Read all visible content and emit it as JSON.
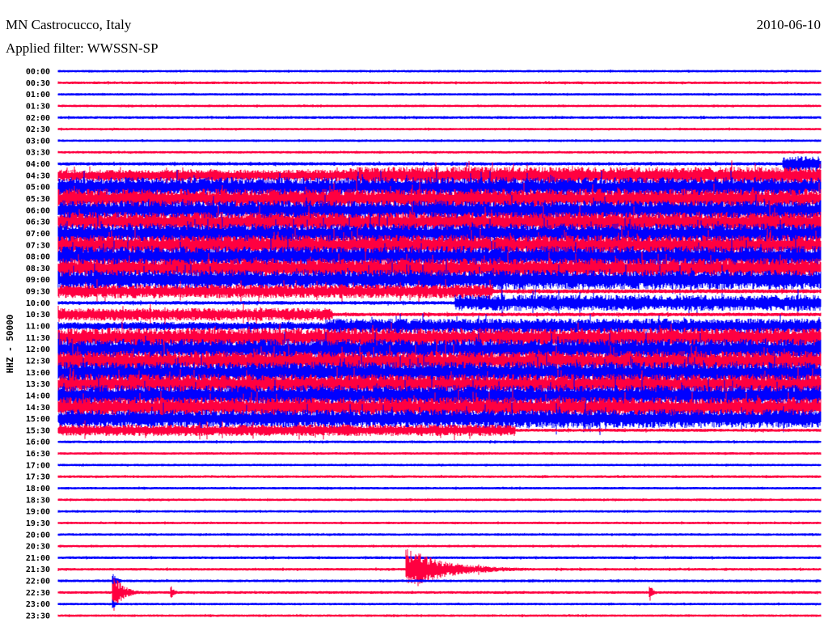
{
  "header": {
    "station": "MN Castrocucco, Italy",
    "date": "2010-06-10",
    "filter": "Applied filter: WWSSN-SP"
  },
  "chart_data": {
    "type": "line",
    "title": "MN Castrocucco, Italy",
    "ylabel": "HHZ - 50000",
    "xlabel": "",
    "row_minutes": 30,
    "colors": {
      "even": "#0000ff",
      "odd": "#ff0040"
    },
    "rows": [
      {
        "label": "00:00",
        "level": 0.05
      },
      {
        "label": "00:30",
        "level": 0.06
      },
      {
        "label": "01:00",
        "level": 0.05
      },
      {
        "label": "01:30",
        "level": 0.05
      },
      {
        "label": "02:00",
        "level": 0.06
      },
      {
        "label": "02:30",
        "level": 0.05
      },
      {
        "label": "03:00",
        "level": 0.05
      },
      {
        "label": "03:30",
        "level": 0.05
      },
      {
        "label": "04:00",
        "level": 0.09,
        "segments": [
          [
            0.95,
            1.0,
            0.6
          ]
        ]
      },
      {
        "label": "04:30",
        "level": 0.7,
        "segments": [
          [
            0.0,
            0.38,
            0.45
          ]
        ]
      },
      {
        "label": "05:00",
        "level": 0.8
      },
      {
        "label": "05:30",
        "level": 0.8
      },
      {
        "label": "06:00",
        "level": 0.8
      },
      {
        "label": "06:30",
        "level": 0.8
      },
      {
        "label": "07:00",
        "level": 0.8
      },
      {
        "label": "07:30",
        "level": 0.8
      },
      {
        "label": "08:00",
        "level": 0.85
      },
      {
        "label": "08:30",
        "level": 0.8
      },
      {
        "label": "09:00",
        "level": 0.8
      },
      {
        "label": "09:30",
        "level": 0.55,
        "segments": [
          [
            0.57,
            1.0,
            0.12
          ]
        ]
      },
      {
        "label": "10:00",
        "level": 0.1,
        "segments": [
          [
            0.52,
            1.0,
            0.65
          ]
        ]
      },
      {
        "label": "10:30",
        "level": 0.1,
        "segments": [
          [
            0.0,
            0.36,
            0.5
          ]
        ]
      },
      {
        "label": "11:00",
        "level": 0.3,
        "segments": [
          [
            0.35,
            1.0,
            0.6
          ]
        ]
      },
      {
        "label": "11:30",
        "level": 0.8
      },
      {
        "label": "12:00",
        "level": 0.85
      },
      {
        "label": "12:30",
        "level": 0.8
      },
      {
        "label": "13:00",
        "level": 0.85
      },
      {
        "label": "13:30",
        "level": 0.8
      },
      {
        "label": "14:00",
        "level": 0.85
      },
      {
        "label": "14:30",
        "level": 0.8
      },
      {
        "label": "15:00",
        "level": 0.75
      },
      {
        "label": "15:30",
        "level": 0.08,
        "segments": [
          [
            0.0,
            0.6,
            0.45
          ]
        ]
      },
      {
        "label": "16:00",
        "level": 0.06
      },
      {
        "label": "16:30",
        "level": 0.05
      },
      {
        "label": "17:00",
        "level": 0.05
      },
      {
        "label": "17:30",
        "level": 0.06
      },
      {
        "label": "18:00",
        "level": 0.05
      },
      {
        "label": "18:30",
        "level": 0.05
      },
      {
        "label": "19:00",
        "level": 0.05
      },
      {
        "label": "19:30",
        "level": 0.05
      },
      {
        "label": "20:00",
        "level": 0.05
      },
      {
        "label": "20:30",
        "level": 0.05
      },
      {
        "label": "21:00",
        "level": 0.06
      },
      {
        "label": "21:30",
        "level": 0.06,
        "events": [
          [
            0.455,
            1.8,
            0.05
          ],
          [
            0.468,
            1.6,
            0.04
          ]
        ]
      },
      {
        "label": "22:00",
        "level": 0.06,
        "events": [
          [
            0.07,
            1.0,
            0.005
          ]
        ]
      },
      {
        "label": "22:30",
        "level": 0.06,
        "events": [
          [
            0.07,
            2.0,
            0.012
          ],
          [
            0.147,
            0.7,
            0.004
          ],
          [
            0.775,
            0.9,
            0.004
          ]
        ]
      },
      {
        "label": "23:00",
        "level": 0.05,
        "events": [
          [
            0.07,
            0.8,
            0.003
          ]
        ]
      },
      {
        "label": "23:30",
        "level": 0.05
      }
    ]
  }
}
